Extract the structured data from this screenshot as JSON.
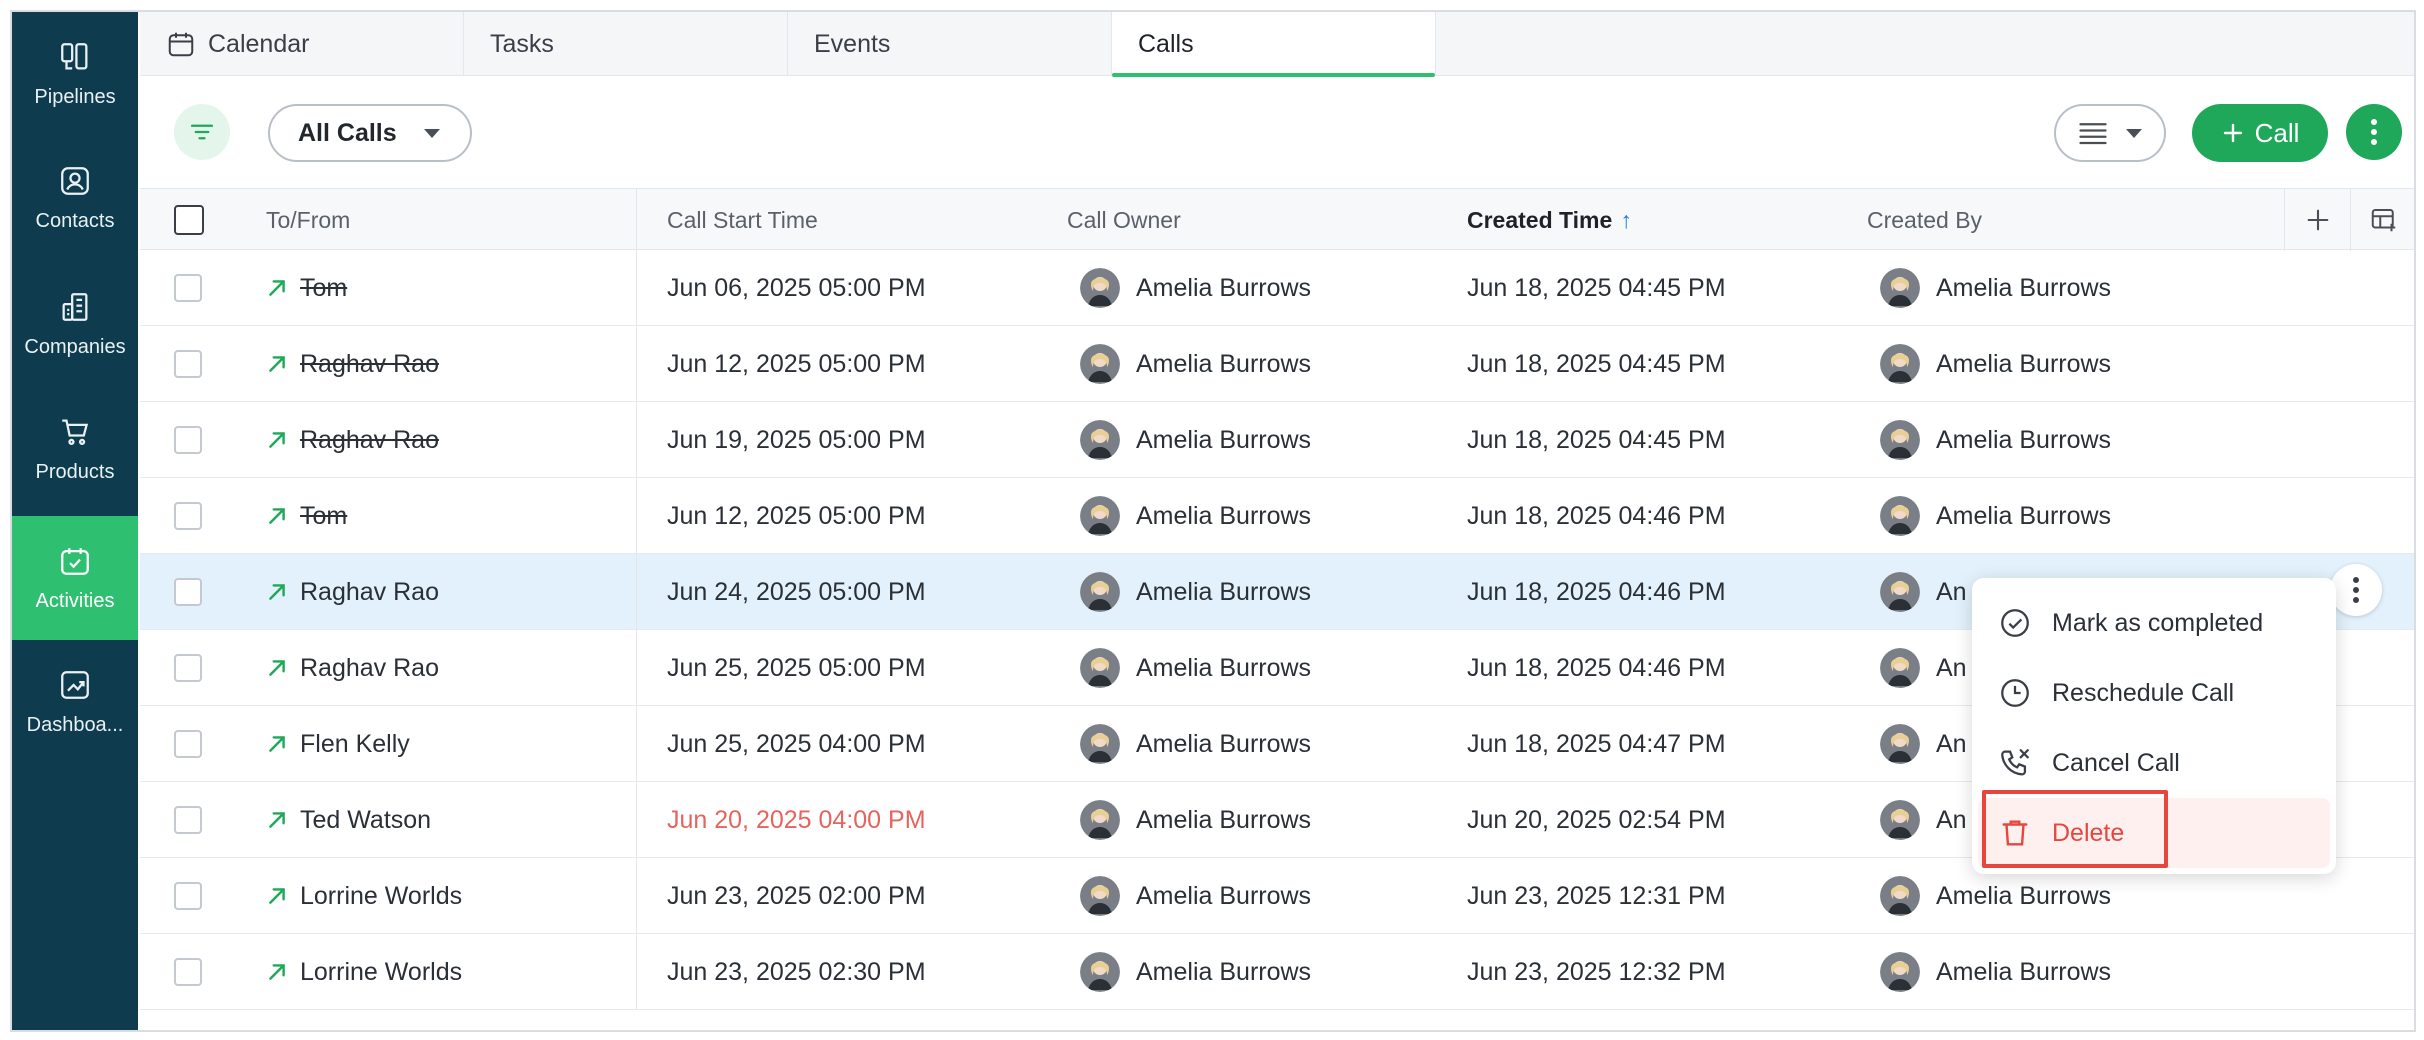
{
  "sidebar": {
    "items": [
      {
        "label": "Pipelines",
        "icon": "pipelines-icon",
        "active": false
      },
      {
        "label": "Contacts",
        "icon": "contacts-icon",
        "active": false
      },
      {
        "label": "Companies",
        "icon": "companies-icon",
        "active": false
      },
      {
        "label": "Products",
        "icon": "cart-icon",
        "active": false
      },
      {
        "label": "Activities",
        "icon": "activities-icon",
        "active": true
      },
      {
        "label": "Dashboa...",
        "icon": "dashboard-icon",
        "active": false
      }
    ]
  },
  "tabs": [
    {
      "label": "Calendar",
      "icon": "calendar-icon",
      "active": false
    },
    {
      "label": "Tasks",
      "active": false
    },
    {
      "label": "Events",
      "active": false
    },
    {
      "label": "Calls",
      "active": true
    }
  ],
  "toolbar": {
    "view_label": "All Calls",
    "new_call_label": "Call",
    "accent_color": "#1fa85a"
  },
  "table": {
    "columns": [
      "To/From",
      "Call Start Time",
      "Call Owner",
      "Created Time",
      "Created By"
    ],
    "sorted_column": "Created Time",
    "sort_direction": "ascending",
    "rows": [
      {
        "to_from": "Tom",
        "completed": true,
        "start": "Jun 06, 2025 05:00 PM",
        "owner": "Amelia Burrows",
        "created": "Jun 18, 2025 04:45 PM",
        "created_by": "Amelia Burrows"
      },
      {
        "to_from": "Raghav Rao",
        "completed": true,
        "start": "Jun 12, 2025 05:00 PM",
        "owner": "Amelia Burrows",
        "created": "Jun 18, 2025 04:45 PM",
        "created_by": "Amelia Burrows"
      },
      {
        "to_from": "Raghav Rao",
        "completed": true,
        "start": "Jun 19, 2025 05:00 PM",
        "owner": "Amelia Burrows",
        "created": "Jun 18, 2025 04:45 PM",
        "created_by": "Amelia Burrows"
      },
      {
        "to_from": "Tom",
        "completed": true,
        "start": "Jun 12, 2025 05:00 PM",
        "owner": "Amelia Burrows",
        "created": "Jun 18, 2025 04:46 PM",
        "created_by": "Amelia Burrows"
      },
      {
        "to_from": "Raghav Rao",
        "completed": false,
        "start": "Jun 24, 2025 05:00 PM",
        "owner": "Amelia Burrows",
        "created": "Jun 18, 2025 04:46 PM",
        "created_by": "An",
        "selected": true
      },
      {
        "to_from": "Raghav Rao",
        "completed": false,
        "start": "Jun 25, 2025 05:00 PM",
        "owner": "Amelia Burrows",
        "created": "Jun 18, 2025 04:46 PM",
        "created_by": "An"
      },
      {
        "to_from": "Flen Kelly",
        "completed": false,
        "start": "Jun 25, 2025 04:00 PM",
        "owner": "Amelia Burrows",
        "created": "Jun 18, 2025 04:47 PM",
        "created_by": "An"
      },
      {
        "to_from": "Ted Watson",
        "completed": false,
        "start": "Jun 20, 2025 04:00 PM",
        "overdue": true,
        "owner": "Amelia Burrows",
        "created": "Jun 20, 2025 02:54 PM",
        "created_by": "An"
      },
      {
        "to_from": "Lorrine Worlds",
        "completed": false,
        "start": "Jun 23, 2025 02:00 PM",
        "owner": "Amelia Burrows",
        "created": "Jun 23, 2025 12:31 PM",
        "created_by": "Amelia Burrows"
      },
      {
        "to_from": "Lorrine Worlds",
        "completed": false,
        "start": "Jun 23, 2025 02:30 PM",
        "owner": "Amelia Burrows",
        "created": "Jun 23, 2025 12:32 PM",
        "created_by": "Amelia Burrows"
      }
    ]
  },
  "context_menu": {
    "items": [
      {
        "label": "Mark as completed",
        "icon": "check-circle-icon"
      },
      {
        "label": "Reschedule Call",
        "icon": "clock-icon"
      },
      {
        "label": "Cancel Call",
        "icon": "cancel-call-icon"
      },
      {
        "label": "Delete",
        "icon": "trash-icon",
        "danger": true
      }
    ]
  },
  "colors": {
    "sidebar_bg": "#0e3b4d",
    "active_green": "#2fbf71",
    "overdue_red": "#e5645c",
    "danger_red": "#e5473e",
    "selected_row": "#e2f1fb"
  }
}
